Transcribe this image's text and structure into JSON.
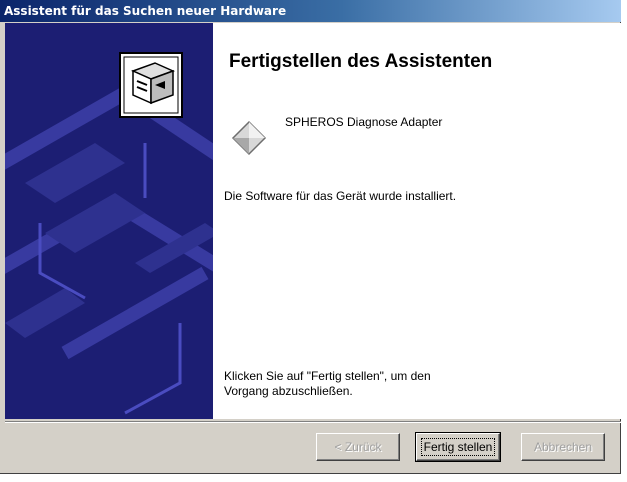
{
  "window": {
    "title": "Assistent für das Suchen neuer Hardware"
  },
  "content": {
    "heading": "Fertigstellen des Assistenten",
    "device_name": "SPHEROS Diagnose Adapter",
    "device_icon": "device-diamond-icon",
    "status": "Die Software für das Gerät wurde installiert.",
    "finish_hint_line1": "Klicken Sie auf \"Fertig stellen\", um den",
    "finish_hint_line2": "Vorgang abzuschließen."
  },
  "buttons": {
    "back": "< Zurück",
    "finish": "Fertig stellen",
    "cancel": "Abbrechen"
  },
  "side_panel": {
    "icon": "hardware-wizard-icon"
  },
  "colors": {
    "titlebar_start": "#0a246a",
    "titlebar_end": "#a6caf0",
    "side_panel": "#1c1e73",
    "dialog_face": "#d4d0c8"
  }
}
